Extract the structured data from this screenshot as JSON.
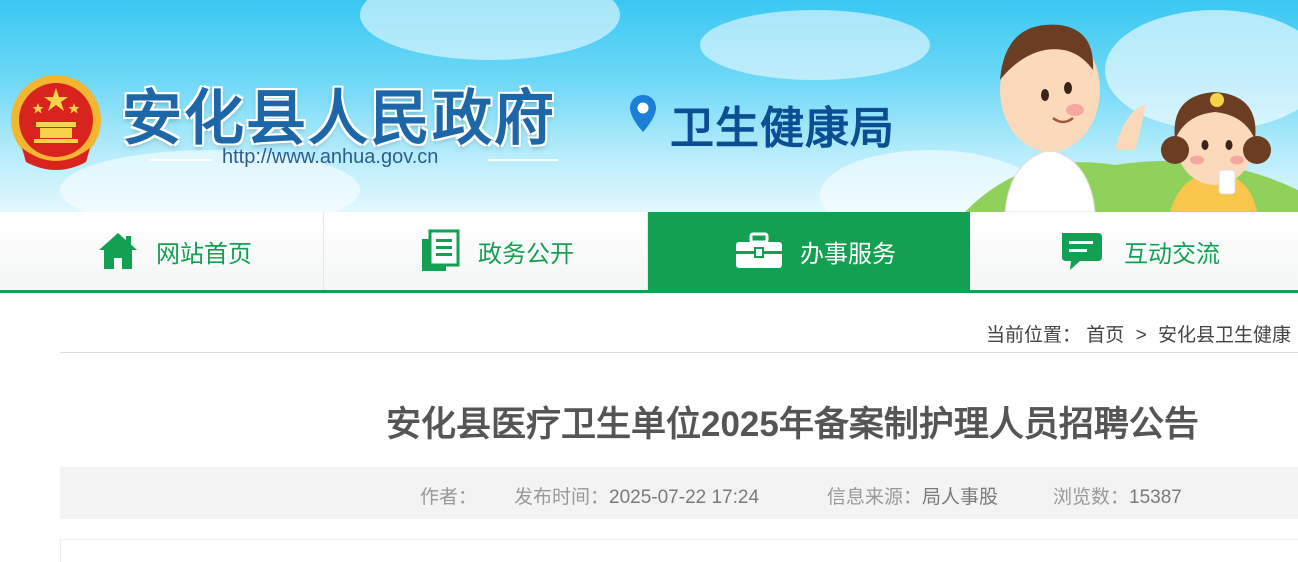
{
  "header": {
    "site_title": "安化县人民政府",
    "site_url": "http://www.anhua.gov.cn",
    "department": "卫生健康局",
    "icons": [
      "national-emblem",
      "location-pin-icon",
      "cartoon-children-illustration"
    ],
    "colors": {
      "title_blue": "#1d66a7",
      "dept_blue": "#0c4e94",
      "sky_blue": "#39c8f2"
    }
  },
  "nav": {
    "accent_color": "#13a053",
    "items": [
      {
        "label": "网站首页",
        "icon": "home-icon",
        "active": false
      },
      {
        "label": "政务公开",
        "icon": "document-icon",
        "active": false
      },
      {
        "label": "办事服务",
        "icon": "briefcase-icon",
        "active": true
      },
      {
        "label": "互动交流",
        "icon": "chat-icon",
        "active": false
      }
    ]
  },
  "breadcrumb": {
    "prefix": "当前位置：",
    "home": "首页",
    "separator": ">",
    "current": "安化县卫生健康"
  },
  "article": {
    "title": "安化县医疗卫生单位2025年备案制护理人员招聘公告",
    "meta": {
      "author_label": "作者：",
      "author": "",
      "publish_time_label": "发布时间：",
      "publish_time": "2025-07-22 17:24",
      "source_label": "信息来源：",
      "source": "局人事股",
      "views_label": "浏览数：",
      "views": "15387"
    }
  }
}
